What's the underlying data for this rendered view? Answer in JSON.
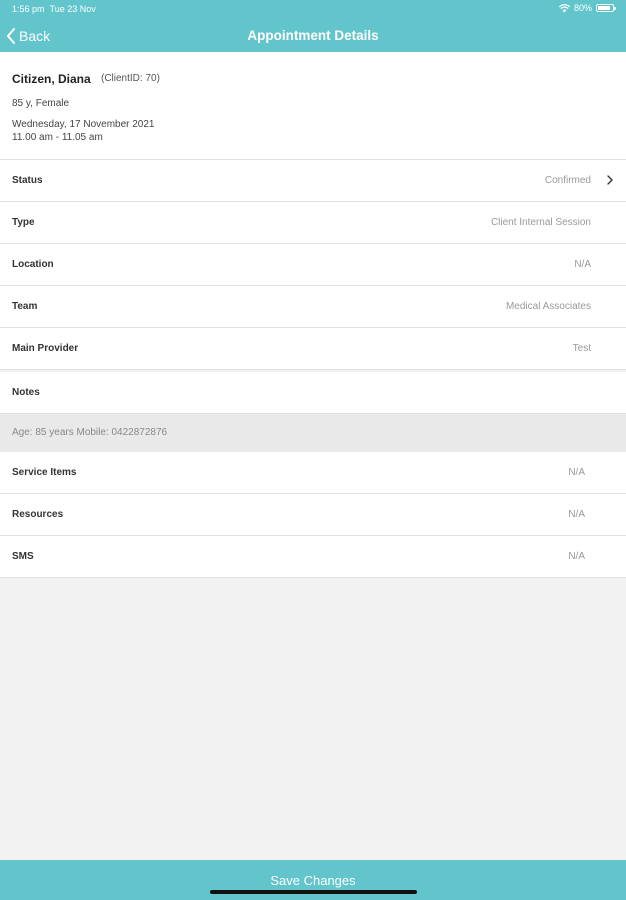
{
  "status_bar": {
    "time": "1:56 pm",
    "date": "Tue 23 Nov",
    "battery": "80%"
  },
  "nav": {
    "back_label": "Back",
    "title": "Appointment Details"
  },
  "client": {
    "name": "Citizen, Diana",
    "client_id": "(ClientID: 70)",
    "demographics": "85 y, Female",
    "date": "Wednesday, 17 November 2021",
    "time": "11.00 am - 11.05 am"
  },
  "rows": [
    {
      "label": "Status",
      "value": "Confirmed"
    },
    {
      "label": "Type",
      "value": "Client Internal Session"
    },
    {
      "label": "Location",
      "value": "N/A"
    },
    {
      "label": "Team",
      "value": "Medical Associates"
    },
    {
      "label": "Main Provider",
      "value": "Test"
    },
    {
      "label": "Notes",
      "value": ""
    }
  ],
  "notes_text": "Age: 85 years Mobile: 0422872876",
  "rows_after_notes": [
    {
      "label": "Service Items",
      "value": "N/A"
    },
    {
      "label": "Resources",
      "value": "N/A"
    },
    {
      "label": "SMS",
      "value": "N/A"
    }
  ],
  "save_button": {
    "label": "Save Changes"
  },
  "colors": {
    "accent": "#62c5cb",
    "background": "#f2f2f2",
    "notes_background": "#e9e9e9"
  }
}
